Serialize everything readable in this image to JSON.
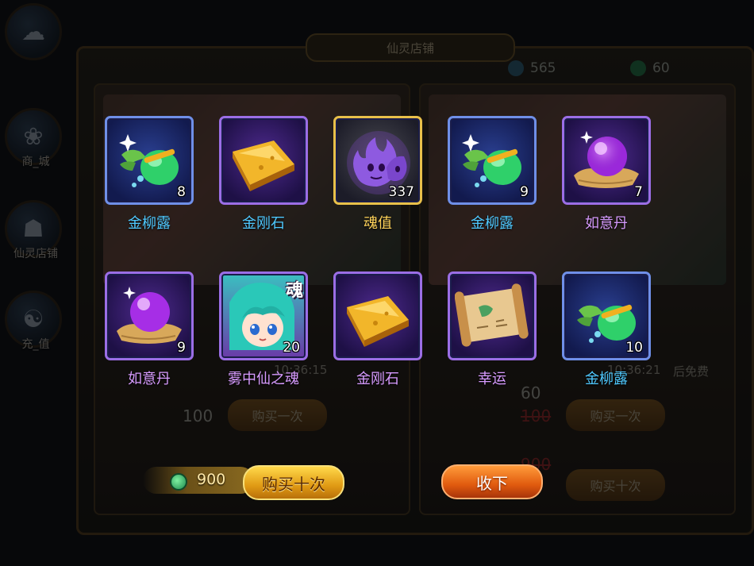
{
  "background": {
    "side_menu": [
      {
        "label": "",
        "icon": "cloud-icon"
      },
      {
        "label": "商_城",
        "icon": "mall-icon"
      },
      {
        "label": "仙灵店铺",
        "icon": "shop-icon"
      },
      {
        "label": "充_值",
        "icon": "recharge-icon"
      }
    ],
    "shop_title": "仙灵店铺",
    "currency": {
      "spirit": "565",
      "jade": "60"
    },
    "left_panel": {
      "timer": "10:36:15",
      "price": "100",
      "buy_once": "购买一次"
    },
    "right_panel": {
      "timer": "10:36:21",
      "free_text": "后免费",
      "price": "60",
      "old_price": "100",
      "price10": "900",
      "buy_once": "购买一次",
      "buy_ten": "购买十次"
    }
  },
  "rewards": [
    {
      "name": "金柳露",
      "count": "8",
      "icon": "gourd-icon",
      "rarity": "blue"
    },
    {
      "name": "金刚石",
      "count": "",
      "icon": "gold-stone-icon",
      "rarity": "purple"
    },
    {
      "name": "魂值",
      "count": "337",
      "icon": "soul-flame-icon",
      "rarity": "gold"
    },
    {
      "name": "金柳露",
      "count": "9",
      "icon": "gourd-icon",
      "rarity": "blue"
    },
    {
      "name": "如意丹",
      "count": "7",
      "icon": "pill-orb-icon",
      "rarity": "purple"
    },
    {
      "name": "如意丹",
      "count": "9",
      "icon": "pill-orb-icon",
      "rarity": "purple"
    },
    {
      "name": "雾中仙之魂",
      "count": "20",
      "icon": "fairy-portrait-icon",
      "rarity": "purple",
      "tag": "魂"
    },
    {
      "name": "金刚石",
      "count": "",
      "icon": "gold-stone-icon",
      "rarity": "purple"
    },
    {
      "name": "幸运",
      "count": "",
      "icon": "scroll-icon",
      "rarity": "purple"
    },
    {
      "name": "金柳露",
      "count": "10",
      "icon": "gourd-icon",
      "rarity": "blue"
    }
  ],
  "footer": {
    "price": "900",
    "buy_ten_label": "购买十次",
    "collect_label": "收下"
  },
  "colors": {
    "blue_name": "#4fc9ff",
    "purple_name": "#d79bff",
    "gold_name": "#ffd35a",
    "buy_button": "#e09a14",
    "collect_button": "#e05a0e"
  }
}
